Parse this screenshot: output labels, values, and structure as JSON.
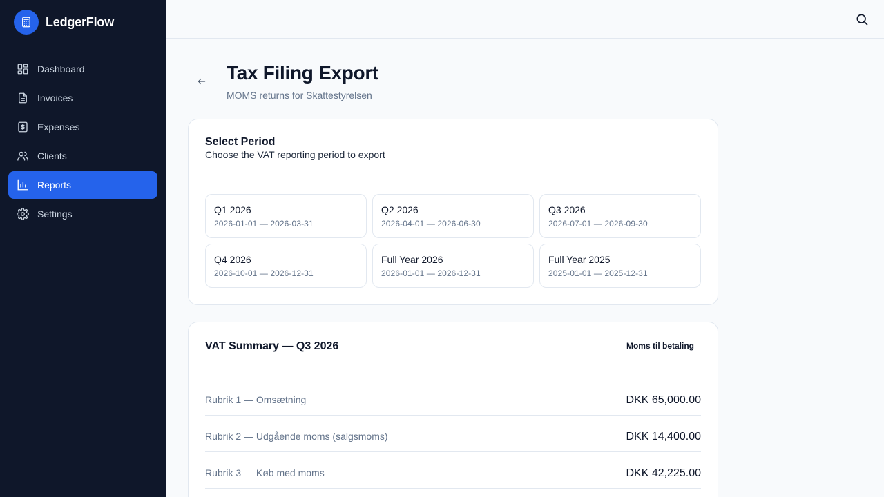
{
  "app": {
    "name": "LedgerFlow",
    "logo_icon": "calculator-icon",
    "accent": "#2563eb"
  },
  "sidebar": {
    "items": [
      {
        "label": "Dashboard",
        "icon": "dashboard-grid-icon",
        "active": false
      },
      {
        "label": "Invoices",
        "icon": "document-icon",
        "active": false
      },
      {
        "label": "Expenses",
        "icon": "dollar-receipt-icon",
        "active": false
      },
      {
        "label": "Clients",
        "icon": "users-icon",
        "active": false
      },
      {
        "label": "Reports",
        "icon": "bar-chart-icon",
        "active": true
      },
      {
        "label": "Settings",
        "icon": "gear-icon",
        "active": false
      }
    ]
  },
  "header": {
    "title": "Tax Filing Export",
    "subtitle": "MOMS returns for Skattestyrelsen"
  },
  "period_card": {
    "title": "Select Period",
    "description": "Choose the VAT reporting period to export",
    "periods": [
      {
        "name": "Q1 2026",
        "range": "2026-01-01 — 2026-03-31"
      },
      {
        "name": "Q2 2026",
        "range": "2026-04-01 — 2026-06-30"
      },
      {
        "name": "Q3 2026",
        "range": "2026-07-01 — 2026-09-30"
      },
      {
        "name": "Q4 2026",
        "range": "2026-10-01 — 2026-12-31"
      },
      {
        "name": "Full Year 2026",
        "range": "2026-01-01 — 2026-12-31"
      },
      {
        "name": "Full Year 2025",
        "range": "2025-01-01 — 2025-12-31"
      }
    ]
  },
  "vat_card": {
    "title": "VAT Summary — Q3 2026",
    "badge": "Moms til betaling",
    "rows": [
      {
        "label": "Rubrik 1 — Omsætning",
        "value": "DKK 65,000.00"
      },
      {
        "label": "Rubrik 2 — Udgående moms (salgsmoms)",
        "value": "DKK 14,400.00"
      },
      {
        "label": "Rubrik 3 — Køb med moms",
        "value": "DKK 42,225.00"
      }
    ]
  }
}
